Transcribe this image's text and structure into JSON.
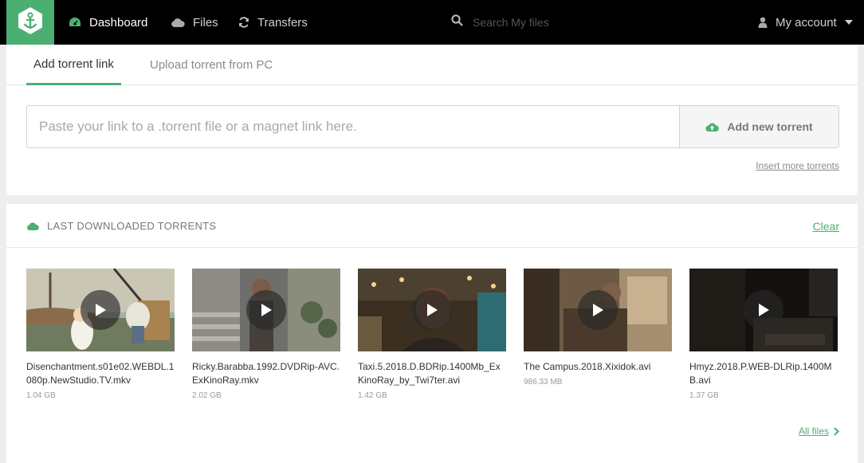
{
  "nav": {
    "logo_icon": "anchor-icon",
    "items": [
      {
        "label": "Dashboard",
        "icon": "dashboard-icon"
      },
      {
        "label": "Files",
        "icon": "cloud-icon"
      },
      {
        "label": "Transfers",
        "icon": "refresh-icon"
      }
    ],
    "search": {
      "placeholder": "Search My files",
      "value": ""
    },
    "account": {
      "label": "My account"
    }
  },
  "upload": {
    "tabs": [
      {
        "label": "Add torrent link",
        "active": true
      },
      {
        "label": "Upload torrent from PC",
        "active": false
      }
    ],
    "link_input": {
      "placeholder": "Paste your link to a .torrent file or a magnet link here.",
      "value": ""
    },
    "add_button": "Add new torrent",
    "insert_more": "Insert more torrents"
  },
  "downloads": {
    "title": "LAST DOWNLOADED TORRENTS",
    "clear_label": "Clear",
    "items": [
      {
        "name": "Disenchantment.s01e02.WEBDL.1080p.NewStudio.TV.mkv",
        "size": "1.04 GB"
      },
      {
        "name": "Ricky.Barabba.1992.DVDRip-AVC.ExKinoRay.mkv",
        "size": "2.02 GB"
      },
      {
        "name": "Taxi.5.2018.D.BDRip.1400Mb_ExKinoRay_by_Twi7ter.avi",
        "size": "1.42 GB"
      },
      {
        "name": "The Campus.2018.Xixidok.avi",
        "size": "986.33 MB"
      },
      {
        "name": "Hmyz.2018.P.WEB-DLRip.1400MB.avi",
        "size": "1.37 GB"
      }
    ],
    "all_files_label": "All files"
  },
  "colors": {
    "accent": "#4caf72",
    "topbar": "#000000"
  }
}
